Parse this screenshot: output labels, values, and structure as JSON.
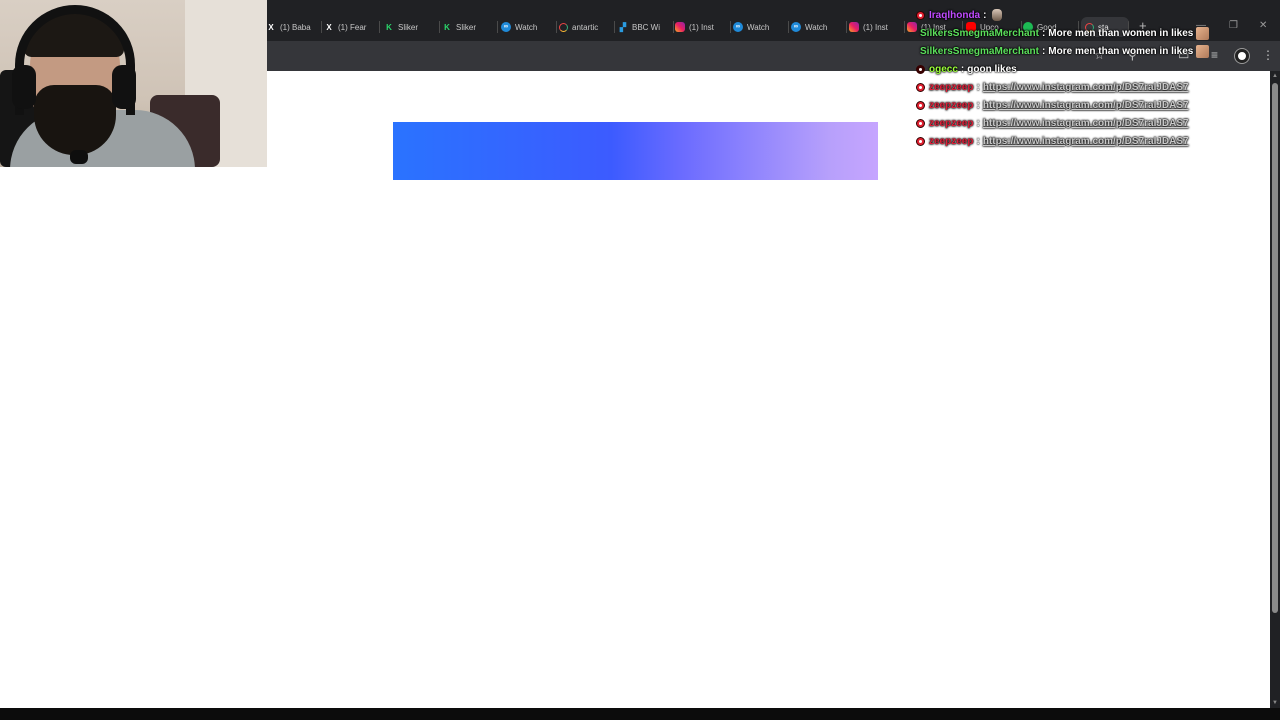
{
  "browser": {
    "tabs": [
      {
        "label": "(1) Baba",
        "icon": "x-icon",
        "kind": "x"
      },
      {
        "label": "(1) Fear",
        "icon": "x-icon",
        "kind": "x"
      },
      {
        "label": "Sliker",
        "icon": "kick-icon",
        "kind": "k"
      },
      {
        "label": "Sliker",
        "icon": "kick-icon",
        "kind": "k"
      },
      {
        "label": "Watch",
        "icon": "stream-icon",
        "kind": "ff"
      },
      {
        "label": "antartic",
        "icon": "google-icon",
        "kind": "g"
      },
      {
        "label": "BBC Wi",
        "icon": "bbc-icon",
        "kind": "bbc"
      },
      {
        "label": "(1) Inst",
        "icon": "instagram-icon",
        "kind": "ig"
      },
      {
        "label": "Watch",
        "icon": "stream-icon",
        "kind": "ff"
      },
      {
        "label": "Watch",
        "icon": "stream-icon",
        "kind": "ff"
      },
      {
        "label": "(1) Inst",
        "icon": "instagram-icon",
        "kind": "ig"
      },
      {
        "label": "(1) Inst",
        "icon": "instagram-icon",
        "kind": "ig"
      },
      {
        "label": "Upco",
        "icon": "youtube-icon",
        "kind": "yt"
      },
      {
        "label": "Good",
        "icon": "spotify-icon",
        "kind": "sp"
      },
      {
        "label": "sta",
        "icon": "google-icon",
        "kind": "g",
        "active": true
      }
    ],
    "new_tab_glyph": "+",
    "window": {
      "minimize": "—",
      "maximize": "❐",
      "close": "✕"
    },
    "toolbar_icons": {
      "star": "☆",
      "ext": "⚲",
      "downloads": "▭",
      "menu": "⋮",
      "media": "≡"
    }
  },
  "chat": {
    "messages": [
      {
        "user": "Iraqlhonda",
        "user_color": "#c04bff",
        "text": "",
        "badge": true,
        "emote": "small"
      },
      {
        "user": "SilkersSmegmaMerchant",
        "user_color": "#5ce05c",
        "text": "More men than women in likes",
        "badge": false,
        "emote": "face"
      },
      {
        "user": "SilkersSmegmaMerchant",
        "user_color": "#5ce05c",
        "text": "More men than women in likes",
        "badge": false,
        "emote": "face"
      },
      {
        "user": "ogecc",
        "user_color": "#9bff3a",
        "text": "goon likes",
        "badge": true,
        "badge_dark": true
      },
      {
        "user": "zeepzeep",
        "user_color": "#e0203a",
        "text": "https://www.instagram.com/p/DS7raIJDAS7",
        "badge": true,
        "link": true
      },
      {
        "user": "zeepzeep",
        "user_color": "#e0203a",
        "text": "https://www.instagram.com/p/DS7raIJDAS7",
        "badge": true,
        "link": true
      },
      {
        "user": "zeepzeep",
        "user_color": "#e0203a",
        "text": "https://www.instagram.com/p/DS7raIJDAS7",
        "badge": true,
        "link": true
      },
      {
        "user": "zeepzeep",
        "user_color": "#e0203a",
        "text": "https://www.instagram.com/p/DS7raIJDAS7",
        "badge": true,
        "link": true
      }
    ],
    "separator": ":"
  },
  "colors": {
    "banner_start": "#2a73ff",
    "banner_end": "#c6a5ff",
    "chrome_dark": "#202124",
    "toolbar": "#35363a"
  }
}
